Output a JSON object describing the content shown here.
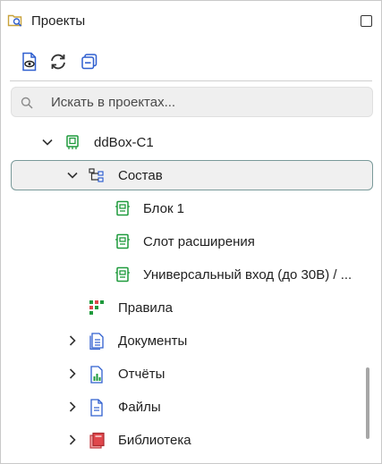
{
  "header": {
    "title": "Проекты",
    "icon": "project-search-icon",
    "maximize_icon": "maximize-icon"
  },
  "toolbar": {
    "buttons": [
      {
        "name": "preview-document-icon"
      },
      {
        "name": "refresh-icon"
      },
      {
        "name": "collapse-all-icon"
      }
    ]
  },
  "search": {
    "placeholder": "Искать в проектах..."
  },
  "tree": {
    "root": {
      "label": "ddBox-C1",
      "icon": "device-icon",
      "expanded": true
    },
    "composition": {
      "label": "Состав",
      "icon": "hierarchy-icon",
      "expanded": true,
      "selected": true
    },
    "children": [
      {
        "label": "Блок 1",
        "icon": "module-icon"
      },
      {
        "label": "Слот расширения",
        "icon": "module-icon"
      },
      {
        "label": "Универсальный вход (до 30В) / ...",
        "icon": "module-icon"
      }
    ],
    "rules": {
      "label": "Правила",
      "icon": "rules-icon"
    },
    "documents": {
      "label": "Документы",
      "icon": "documents-icon"
    },
    "reports": {
      "label": "Отчёты",
      "icon": "reports-icon"
    },
    "files": {
      "label": "Файлы",
      "icon": "file-icon"
    },
    "library": {
      "label": "Библиотека",
      "icon": "library-icon"
    }
  },
  "colors": {
    "green": "#1e9a3c",
    "blue": "#2f5fcf",
    "red": "#e0474c",
    "selection_border": "#7a9a9a"
  }
}
